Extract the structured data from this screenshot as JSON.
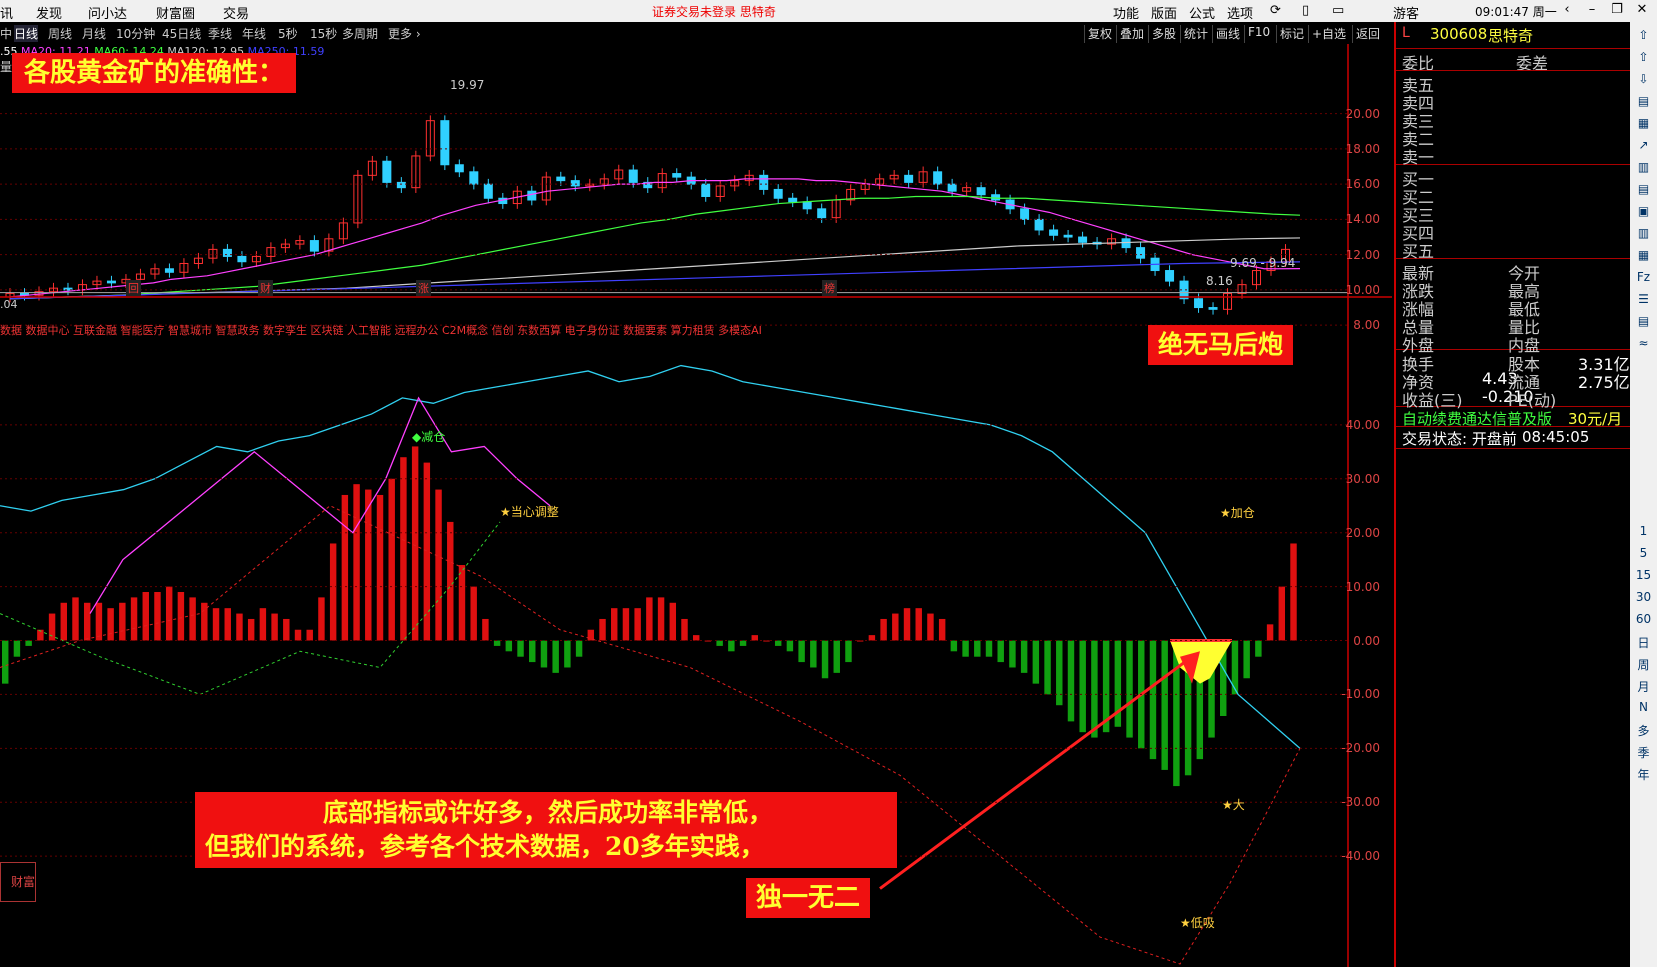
{
  "menu": {
    "left_items": [
      "讯",
      "发现",
      "问小达",
      "财富圈",
      "交易"
    ],
    "center_notice": "证券交易未登录  思特奇",
    "right_items": [
      "功能",
      "版面",
      "公式",
      "选项"
    ],
    "user": "游客",
    "clock": "09:01:47 周一"
  },
  "period_bar": {
    "items": [
      "中",
      "日线",
      "周线",
      "月线",
      "10分钟",
      "45日线",
      "季线",
      "年线",
      "5秒",
      "15秒",
      "多周期",
      "更多 ›"
    ],
    "active": "日线",
    "ma_legend": [
      {
        "text": ".55",
        "color": "#ffffff"
      },
      {
        "text": "MA20: 11.21",
        "color": "#ff40ff"
      },
      {
        "text": "MA60: 14.24",
        "color": "#40ff40"
      },
      {
        "text": "MA120: 12.95",
        "color": "#cccccc"
      },
      {
        "text": "MA250: 11.59",
        "color": "#4040ff"
      }
    ],
    "volume_tag": "量"
  },
  "tool_buttons": [
    "复权",
    "叠加",
    "多股",
    "统计",
    "画线",
    "F10",
    "标记",
    "+自选",
    "返回"
  ],
  "stock": {
    "marker": "L",
    "code": "300608",
    "name": "思特奇"
  },
  "quote_panel": {
    "header": [
      "委比",
      "委差"
    ],
    "sell_rows": [
      "卖五",
      "卖四",
      "卖三",
      "卖二",
      "卖一"
    ],
    "buy_rows": [
      "买一",
      "买二",
      "买三",
      "买四",
      "买五"
    ],
    "stats_left": [
      "最新",
      "涨跌",
      "涨幅",
      "总量",
      "外盘"
    ],
    "stats_right": [
      "今开",
      "最高",
      "最低",
      "量比",
      "内盘"
    ],
    "fund_rows": [
      {
        "l": "换手",
        "m": "",
        "r1": "股本",
        "r2": "3.31亿"
      },
      {
        "l": "净资",
        "m": "4.43",
        "r1": "流通",
        "r2": "2.75亿"
      },
      {
        "l": "收益(三)",
        "m": "-0.210",
        "r1": "PE(动)",
        "r2": ""
      }
    ],
    "promo": "自动续费通达信普及版",
    "promo_price": "30元/月",
    "trade_status_label": "交易状态: 开盘前",
    "trade_status_time": "08:45:05"
  },
  "icon_strip": [
    "1",
    "5",
    "15",
    "30",
    "60",
    "日",
    "周",
    "月",
    "N",
    "多",
    "季",
    "年"
  ],
  "price_axis": [
    "20.00",
    "18.00",
    "16.00",
    "14.00",
    "12.00",
    "10.00",
    "8.00"
  ],
  "indicator_axis": [
    "40.00",
    "30.00",
    "20.00",
    "10.00",
    "0.00",
    "-10.00",
    "-20.00",
    "-30.00",
    "-40.00"
  ],
  "chart_annotations": {
    "high": "19.97",
    "low": "8.16",
    "range": "9.69 - 9.94",
    "event_tags": [
      "回",
      "财",
      "涨",
      "榜"
    ],
    "indicator_prefix": ".04",
    "concepts": "数据 数据中心 互联金融 智能医疗 智慧城市 智慧政务 数字孪生 区块链 人工智能 远程办公 C2M概念 信创 东数西算 电子身份证 数据要素 算力租赁 多模态AI",
    "signals": [
      "减仓",
      "当心调整",
      "加仓",
      "大",
      "低吸"
    ],
    "bottom_left_tag": "财富"
  },
  "banners": {
    "title": "各股黄金矿的准确性：",
    "no_lag": "绝无马后炮",
    "message_line1": "底部指标或许好多，然后成功率非常低，",
    "message_line2": "但我们的系统，参考各个技术数据，20多年实践，",
    "unique": "独一无二"
  },
  "chart_data": [
    {
      "type": "candlestick",
      "title": "",
      "ylim": [
        7.5,
        21
      ],
      "series": [
        {
          "name": "close",
          "values": [
            9.8,
            9.7,
            9.9,
            10.1,
            10.0,
            10.3,
            10.5,
            10.4,
            10.6,
            10.9,
            11.2,
            11.0,
            11.5,
            11.8,
            12.3,
            11.9,
            11.6,
            11.9,
            12.4,
            12.6,
            12.8,
            12.2,
            12.9,
            13.8,
            16.5,
            17.3,
            16.1,
            15.8,
            17.6,
            19.6,
            17.1,
            16.7,
            16.0,
            15.2,
            14.9,
            15.6,
            15.1,
            16.4,
            16.2,
            15.9,
            16.0,
            16.3,
            16.8,
            16.1,
            15.8,
            16.6,
            16.4,
            16.0,
            15.3,
            15.9,
            16.2,
            16.5,
            15.7,
            15.2,
            15.0,
            14.6,
            14.1,
            15.1,
            15.7,
            16.0,
            16.3,
            16.5,
            16.1,
            16.7,
            16.0,
            15.6,
            15.8,
            15.4,
            15.1,
            14.6,
            14.0,
            13.4,
            13.1,
            13.0,
            12.7,
            12.6,
            12.9,
            12.4,
            11.8,
            11.1,
            10.5,
            9.5,
            9.0,
            8.9,
            9.8,
            10.3,
            11.1,
            11.6,
            12.3
          ]
        }
      ],
      "ma_lines": [
        {
          "name": "MA20",
          "values": [
            9.6,
            9.7,
            9.8,
            9.9,
            10.0,
            10.1,
            10.2,
            10.3,
            10.4,
            10.6,
            10.7,
            10.8,
            11.0,
            11.2,
            11.4,
            11.6,
            11.8,
            12.0,
            12.3,
            12.6,
            12.9,
            13.2,
            13.5,
            13.8,
            14.2,
            14.5,
            14.8,
            15.0,
            15.2,
            15.4,
            15.6,
            15.7,
            15.8,
            15.9,
            16.0,
            16.0,
            16.1,
            16.1,
            16.2,
            16.2,
            16.2,
            16.3,
            16.3,
            16.3,
            16.3,
            16.2,
            16.2,
            16.1,
            16.0,
            15.9,
            15.8,
            15.7,
            15.6,
            15.4,
            15.2,
            15.0,
            14.8,
            14.6,
            14.4,
            14.1,
            13.8,
            13.5,
            13.2,
            12.9,
            12.6,
            12.3,
            12.0,
            11.8,
            11.6,
            11.4,
            11.2,
            11.2,
            11.21
          ]
        },
        {
          "name": "MA60",
          "values": [
            9.5,
            9.55,
            9.6,
            9.65,
            9.7,
            9.8,
            9.9,
            10.0,
            10.1,
            10.2,
            10.4,
            10.6,
            10.8,
            11.0,
            11.2,
            11.4,
            11.7,
            12.0,
            12.3,
            12.6,
            12.9,
            13.2,
            13.5,
            13.8,
            14.0,
            14.3,
            14.5,
            14.7,
            14.9,
            15.0,
            15.1,
            15.2,
            15.2,
            15.3,
            15.3,
            15.3,
            15.2,
            15.2,
            15.1,
            15.0,
            14.9,
            14.8,
            14.7,
            14.6,
            14.5,
            14.4,
            14.3,
            14.24
          ]
        },
        {
          "name": "MA120",
          "values": [
            9.5,
            9.6,
            9.7,
            9.8,
            9.9,
            10.0,
            10.1,
            10.3,
            10.5,
            10.7,
            10.9,
            11.1,
            11.3,
            11.5,
            11.7,
            11.9,
            12.1,
            12.3,
            12.5,
            12.6,
            12.7,
            12.8,
            12.9,
            12.95
          ]
        },
        {
          "name": "MA250",
          "values": [
            9.5,
            9.6,
            9.7,
            9.8,
            9.9,
            10.0,
            10.1,
            10.2,
            10.3,
            10.4,
            10.5,
            10.6,
            10.7,
            10.8,
            10.9,
            11.0,
            11.1,
            11.2,
            11.3,
            11.4,
            11.5,
            11.55,
            11.59
          ]
        }
      ]
    },
    {
      "type": "bar",
      "title": "",
      "ylim": [
        -60,
        55
      ],
      "series": [
        {
          "name": "histogram",
          "values": [
            -8,
            -3,
            -1,
            2,
            5,
            7,
            8,
            7,
            7,
            6,
            7,
            8,
            9,
            9,
            10,
            9,
            8,
            7,
            6,
            6,
            5,
            4,
            6,
            5,
            4,
            2,
            2,
            8,
            18,
            27,
            29,
            28,
            27,
            30,
            34,
            36,
            33,
            28,
            22,
            14,
            10,
            4,
            -1,
            -2,
            -3,
            -4,
            -5,
            -6,
            -5,
            -3,
            2,
            4,
            6,
            6,
            6,
            8,
            8,
            7,
            4,
            1,
            0,
            -1,
            -2,
            -1,
            1,
            0,
            -1,
            -2,
            -4,
            -5,
            -7,
            -6,
            -4,
            0,
            1,
            4,
            5,
            6,
            6,
            5,
            4,
            -2,
            -3,
            -3,
            -3,
            -4,
            -5,
            -6,
            -8,
            -10,
            -12,
            -15,
            -17,
            -18,
            -17,
            -16,
            -18,
            -20,
            -22,
            -24,
            -27,
            -25,
            -22,
            -18,
            -14,
            -10,
            -7,
            -3,
            3,
            10,
            18
          ]
        },
        {
          "name": "cyan-line",
          "values": [
            25,
            24,
            26,
            27,
            28,
            30,
            33,
            36,
            35,
            37,
            38,
            40,
            42,
            45,
            44,
            46,
            47,
            48,
            49,
            50,
            48,
            49,
            51,
            50,
            48,
            47,
            46,
            45,
            44,
            43,
            42,
            41,
            40,
            38,
            35,
            30,
            25,
            20,
            10,
            0,
            -10,
            -15,
            -20
          ]
        },
        {
          "name": "magenta-line",
          "values": [
            5,
            15,
            20,
            25,
            30,
            35,
            30,
            25,
            20,
            30,
            45,
            35,
            36,
            30,
            25
          ]
        }
      ]
    }
  ]
}
